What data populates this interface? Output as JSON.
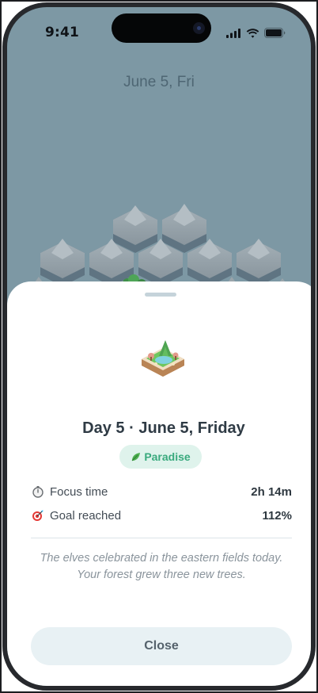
{
  "status_bar": {
    "time": "9:41"
  },
  "header": {
    "date": "June 5, Fri"
  },
  "sheet": {
    "title": "Day 5 · June 5, Friday",
    "badge": {
      "icon": "leaf-icon",
      "label": "Paradise",
      "color": "#3aaa7e"
    },
    "stats": [
      {
        "icon": "stopwatch-icon",
        "label": "Focus time",
        "value": "2h 14m"
      },
      {
        "icon": "target-icon",
        "label": "Goal reached",
        "value": "112%"
      }
    ],
    "note": "The elves celebrated in the eastern fields today. Your forest grew three new trees.",
    "close_label": "Close"
  },
  "colors": {
    "background": "#7d98a4",
    "sheet": "#ffffff",
    "accent": "#3aaa7e"
  }
}
